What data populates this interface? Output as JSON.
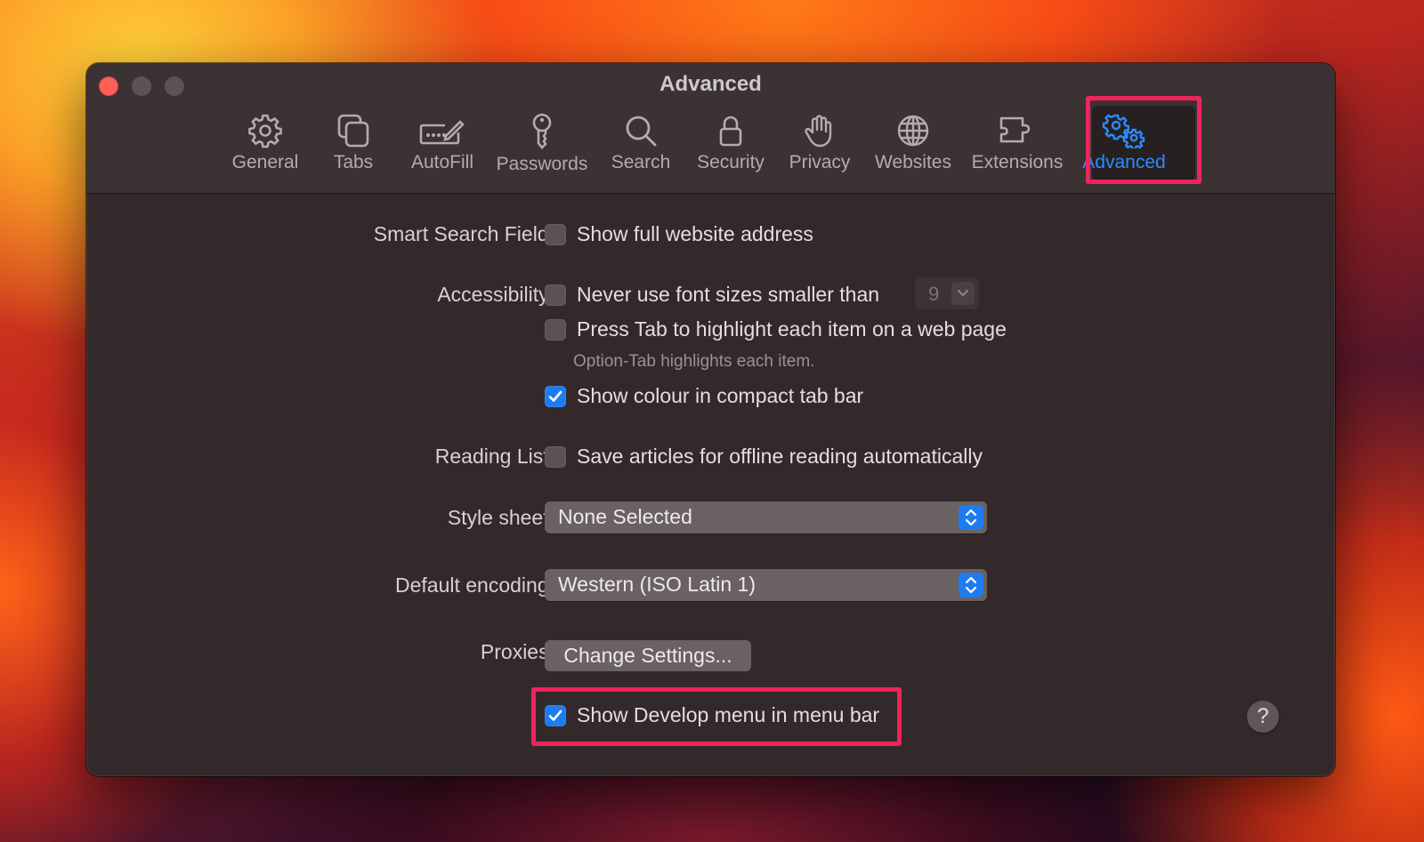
{
  "window": {
    "title": "Advanced"
  },
  "toolbar": {
    "items": [
      {
        "label": "General",
        "icon": "gear-icon"
      },
      {
        "label": "Tabs",
        "icon": "tabs-icon"
      },
      {
        "label": "AutoFill",
        "icon": "autofill-pencil-icon"
      },
      {
        "label": "Passwords",
        "icon": "key-icon"
      },
      {
        "label": "Search",
        "icon": "magnifier-icon"
      },
      {
        "label": "Security",
        "icon": "lock-icon"
      },
      {
        "label": "Privacy",
        "icon": "hand-icon"
      },
      {
        "label": "Websites",
        "icon": "globe-icon"
      },
      {
        "label": "Extensions",
        "icon": "puzzle-icon"
      },
      {
        "label": "Advanced",
        "icon": "double-gear-icon",
        "selected": true
      }
    ]
  },
  "settings": {
    "smart_search": {
      "label": "Smart Search Field:",
      "show_full_address": {
        "text": "Show full website address",
        "checked": false
      }
    },
    "accessibility": {
      "label": "Accessibility:",
      "min_font": {
        "text": "Never use font sizes smaller than",
        "checked": false,
        "value": "9"
      },
      "tab_highlight": {
        "text": "Press Tab to highlight each item on a web page",
        "checked": false
      },
      "hint": "Option-Tab highlights each item.",
      "compact_colour": {
        "text": "Show colour in compact tab bar",
        "checked": true
      }
    },
    "reading_list": {
      "label": "Reading List:",
      "offline": {
        "text": "Save articles for offline reading automatically",
        "checked": false
      }
    },
    "style_sheet": {
      "label": "Style sheet:",
      "value": "None Selected"
    },
    "default_encoding": {
      "label": "Default encoding:",
      "value": "Western (ISO Latin 1)"
    },
    "proxies": {
      "label": "Proxies:",
      "button": "Change Settings..."
    },
    "develop_menu": {
      "text": "Show Develop menu in menu bar",
      "checked": true
    }
  },
  "help": {
    "label": "?"
  },
  "colors": {
    "accent": "#1f7cf0",
    "selected_tab": "#2b8cff",
    "highlight_box": "#f0245a",
    "close_button": "#fe5f57"
  }
}
